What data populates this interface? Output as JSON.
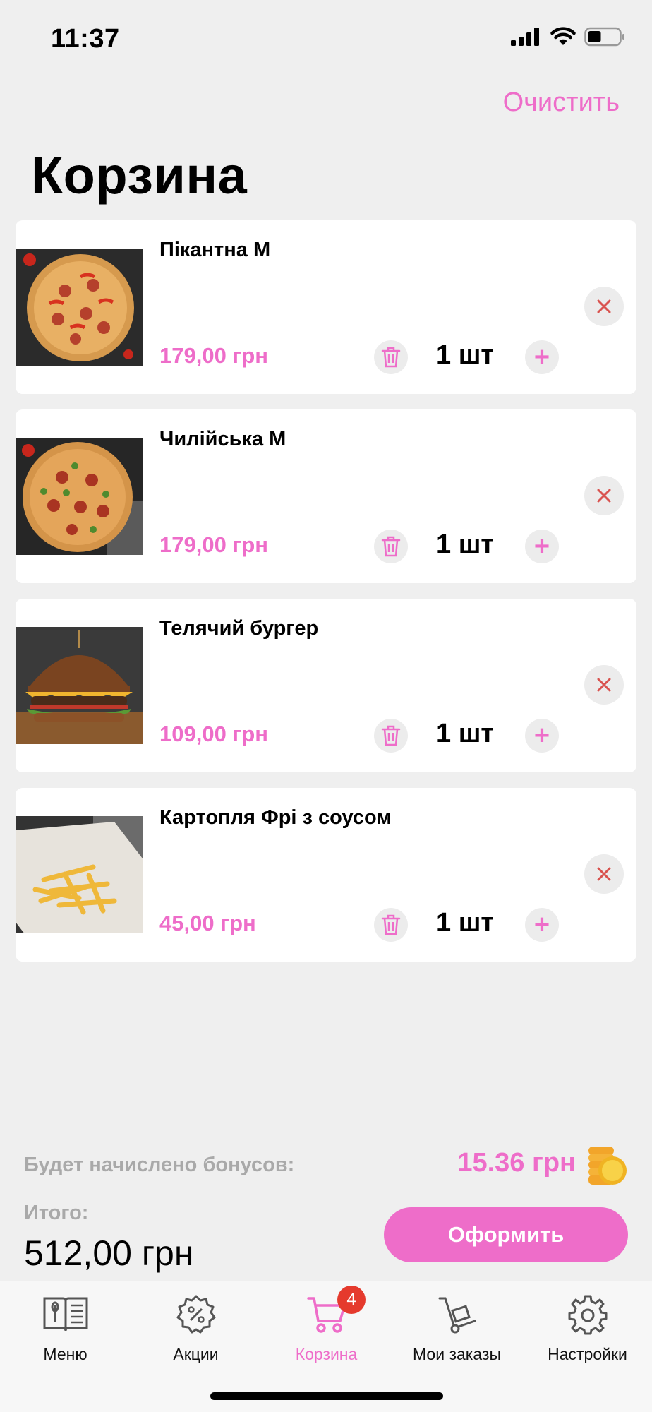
{
  "status_bar": {
    "time": "11:37"
  },
  "header": {
    "clear_label": "Очистить",
    "title": "Корзина"
  },
  "colors": {
    "accent": "#ee6dc9",
    "remove_icon": "#d9534f",
    "badge": "#e53a2d",
    "background": "#efefef"
  },
  "cart_items": [
    {
      "name": "Пікантна М",
      "price": "179,00 грн",
      "quantity": "1 шт",
      "image": "pizza-picante"
    },
    {
      "name": "Чилійська М",
      "price": "179,00 грн",
      "quantity": "1 шт",
      "image": "pizza-chili"
    },
    {
      "name": "Телячий бургер",
      "price": "109,00 грн",
      "quantity": "1 шт",
      "image": "veal-burger"
    },
    {
      "name": "Картопля Фрі з соусом",
      "price": "45,00 грн",
      "quantity": "1 шт",
      "image": "french-fries"
    }
  ],
  "summary": {
    "bonus_label": "Будет начислено бонусов:",
    "bonus_value": "15.36 грн",
    "total_label": "Итого:",
    "total_value": "512,00 грн",
    "checkout_label": "Оформить"
  },
  "tab_bar": {
    "tabs": [
      {
        "label": "Меню",
        "icon": "menu-book-icon"
      },
      {
        "label": "Акции",
        "icon": "percent-gear-icon"
      },
      {
        "label": "Корзина",
        "icon": "cart-icon",
        "active": true,
        "badge": "4"
      },
      {
        "label": "Мои заказы",
        "icon": "hand-truck-icon"
      },
      {
        "label": "Настройки",
        "icon": "gear-icon"
      }
    ]
  }
}
